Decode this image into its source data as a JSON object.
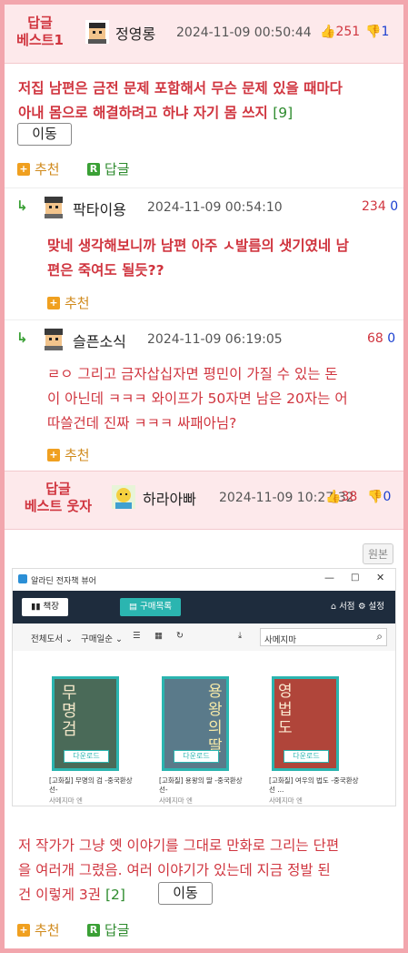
{
  "post1": {
    "best_label": [
      "답글",
      "베스트1"
    ],
    "nick": "정영롱",
    "date": "2024-11-09 00:50:44",
    "up": "251",
    "down": "1",
    "text_line1": "저집 남편은 금전 문제 포함해서 무슨 문제 있을 때마다",
    "text_line2": "아내 몸으로 해결하려고 하냐 자기 몸 쓰지",
    "reply_count": "[9]",
    "move_label": "이동",
    "recommend_label": "추천",
    "reply_label": "답글"
  },
  "reply1": {
    "nick": "팍타이용",
    "date": "2024-11-09 00:54:10",
    "up": "234",
    "down": "0",
    "line1": "맞네 생각해보니까 남편 아주 ㅅ발름의 샛기였네 남",
    "line2": "편은 죽여도 될듯??",
    "recommend_label": "추천"
  },
  "reply2": {
    "nick": "슬픈소식",
    "date": "2024-11-09 06:19:05",
    "up": "68",
    "down": "0",
    "line1": "ㄹㅇ 그리고 금자삽십자면 평민이 가질 수 있는 돈",
    "line2": "이 아닌데 ㅋㅋㅋ 와이프가 50자면 남은 20자는 어",
    "line3": "따쓸건데 진짜 ㅋㅋㅋ 싸패아님?",
    "recommend_label": "추천"
  },
  "post2": {
    "best_label": [
      "답글",
      "베스트 웃자"
    ],
    "nick": "하라아빠",
    "date": "2024-11-09 10:27:32",
    "up": "38",
    "down": "0",
    "original_label": "원본",
    "line1": "저 작가가 그냥 옛 이야기를 그대로 만화로 그리는 단편",
    "line2": "을 여러개 그렸음. 여러 이야기가 있는데 지금 정발 된",
    "line3": "건 이렇게 3권",
    "reply_count": "[2]",
    "move_label": "이동",
    "recommend_label": "추천",
    "reply_label": "답글"
  },
  "viewer": {
    "window_title": "알라딘 전자책 뷰어",
    "tab_library": "책장",
    "tab_purchases": "구매목록",
    "store_label": "서점",
    "settings_label": "설정",
    "filter_all": "전체도서",
    "filter_sort": "구매일순",
    "search_value": "사메지마",
    "download_label": "다운로드",
    "books": [
      {
        "cover_title": "무명검",
        "title": "[고화질] 무명의 검 -중국환상선-",
        "author": "사메지마 엔",
        "cover_color": "#4a6a58"
      },
      {
        "cover_title": "용왕의딸",
        "title": "[고화질] 용왕의 딸 -중국환상선-",
        "author": "사메지마 엔",
        "cover_color": "#5a7a8a"
      },
      {
        "cover_title": "영법도",
        "title": "[고화질] 여우의 법도 -중국환상선 ...",
        "author": "사메지마 엔",
        "cover_color": "#b0453a"
      }
    ]
  },
  "colors": {
    "accent_red": "#d0353f",
    "border_pink": "#f2a6ad",
    "header_bg": "#fde9eb",
    "vote_down_blue": "#1a3fd0",
    "reply_green": "#3aa035",
    "recommend_orange": "#f0a020",
    "viewer_dark": "#1e2c3d",
    "viewer_teal": "#2bb5b0"
  }
}
